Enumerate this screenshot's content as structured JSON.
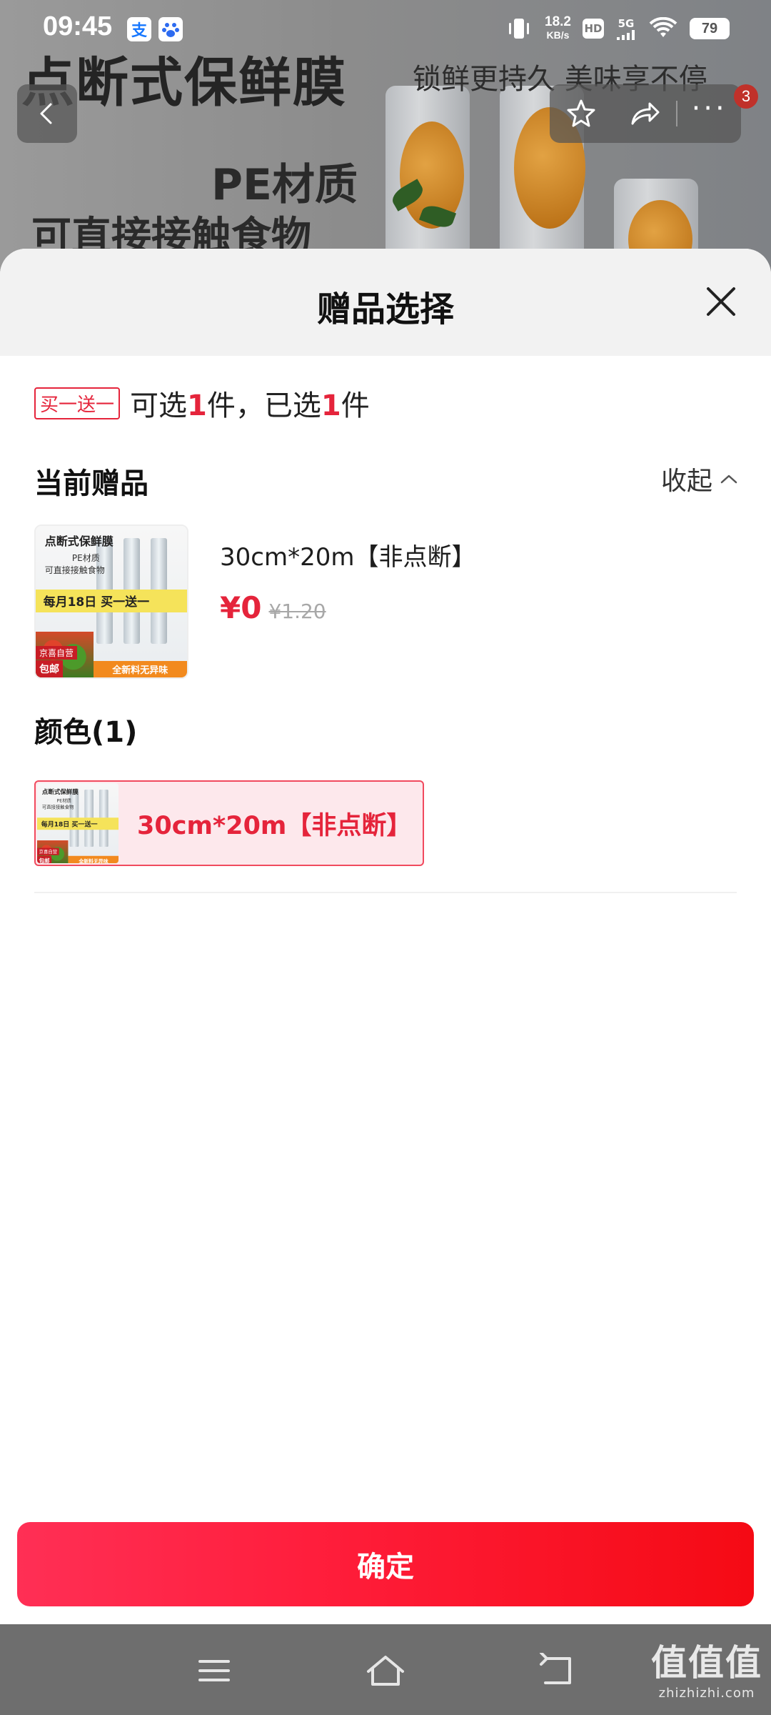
{
  "status_bar": {
    "time": "09:45",
    "alipay_icon_text": "支",
    "net_speed_value": "18.2",
    "net_speed_unit": "KB/s",
    "hd_badge": "HD",
    "network": "5G",
    "battery": "79"
  },
  "background": {
    "product_title": "点断式保鲜膜",
    "slogan": "锁鲜更持久 美味享不停",
    "material": "PE材质",
    "contact": "可直接接触食物"
  },
  "top_nav": {
    "notification_count": "3"
  },
  "sheet": {
    "title": "赠品选择",
    "promo": {
      "tag": "买一送一",
      "text_pre": "可选",
      "selectable_count": "1",
      "text_mid": "件，已选",
      "selected_count": "1",
      "text_post": "件"
    },
    "current_gift_label": "当前赠品",
    "collapse_label": "收起",
    "gift": {
      "name": "30cm*20m【非点断】",
      "price_now": "¥0",
      "price_original": "¥1.20"
    },
    "color_label": "颜色(1)",
    "color_option_label": "30cm*20m【非点断】",
    "confirm_label": "确定"
  },
  "thumbnail": {
    "title": "点断式保鲜膜",
    "sub": "PE材质",
    "sub2": "可直接接触食物",
    "band": "每月18日 买一送一",
    "tag": "京喜自营",
    "tag2": "包邮",
    "footer": "全新料无异味"
  },
  "watermark": {
    "logo": "值值值",
    "url": "zhizhizhi.com"
  },
  "colors": {
    "accent_red": "#e5243b",
    "confirm_gradient_start": "#ff2f55",
    "confirm_gradient_end": "#f50a14",
    "selected_option_bg": "#fde8ec"
  }
}
